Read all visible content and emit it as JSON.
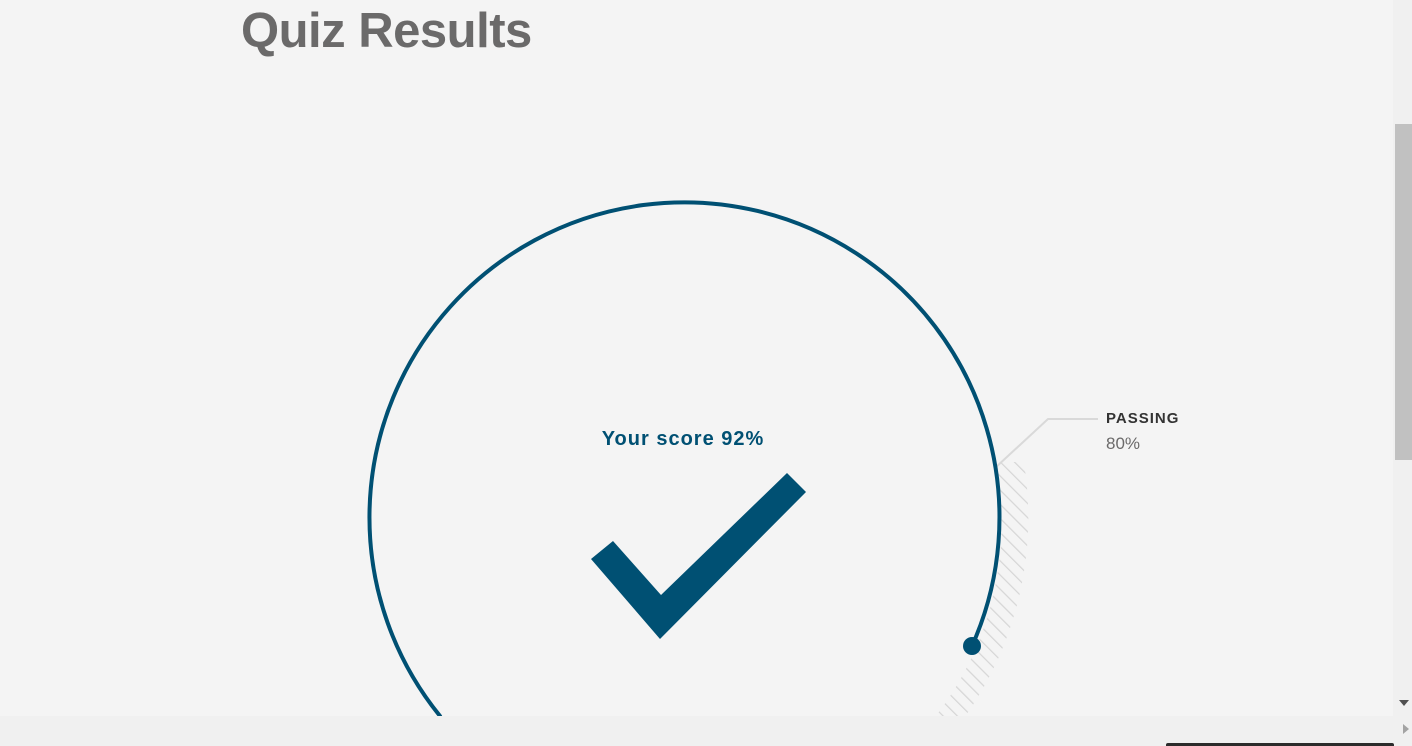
{
  "page": {
    "title": "Quiz Results"
  },
  "result": {
    "score_label": "Your score 92%",
    "score_value": 92,
    "passing_label": "PASSING",
    "passing_value": "80%",
    "passed": true
  },
  "icons": {
    "status": "checkmark-icon"
  },
  "colors": {
    "accent": "#005073",
    "title": "#6b6a6a",
    "background": "#f4f4f4",
    "passing_hatch": "#dcdcdc"
  }
}
